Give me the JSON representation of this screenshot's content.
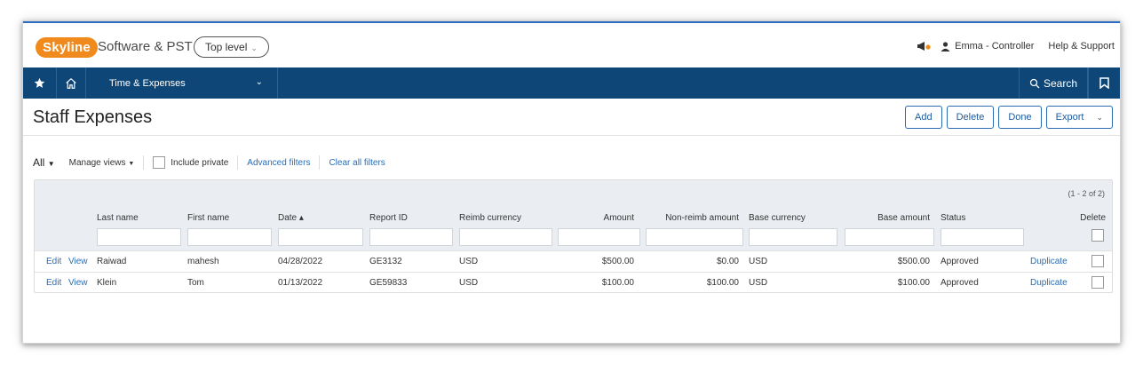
{
  "header": {
    "logo_text": "Skyline",
    "product_name": "Software & PST",
    "level_selector": "Top level",
    "user": "Emma - Controller",
    "help_link": "Help & Support"
  },
  "navbar": {
    "module": "Time & Expenses",
    "search_label": "Search"
  },
  "page": {
    "title": "Staff Expenses",
    "buttons": {
      "add": "Add",
      "delete": "Delete",
      "done": "Done",
      "export": "Export"
    }
  },
  "filters": {
    "view": "All",
    "manage_views": "Manage views",
    "include_private": "Include private",
    "advanced_filters": "Advanced filters",
    "clear_all_filters": "Clear all filters"
  },
  "grid": {
    "record_count": "(1 - 2 of 2)",
    "columns": [
      "Last name",
      "First name",
      "Date ▴",
      "Report ID",
      "Reimb currency",
      "Amount",
      "Non-reimb amount",
      "Base currency",
      "Base amount",
      "Status",
      "Delete"
    ],
    "rows": [
      {
        "edit": "Edit",
        "view": "View",
        "last_name": "Raiwad",
        "first_name": "mahesh",
        "date": "04/28/2022",
        "report_id": "GE3132",
        "reimb_currency": "USD",
        "amount": "$500.00",
        "non_reimb_amount": "$0.00",
        "base_currency": "USD",
        "base_amount": "$500.00",
        "status": "Approved",
        "duplicate": "Duplicate"
      },
      {
        "edit": "Edit",
        "view": "View",
        "last_name": "Klein",
        "first_name": "Tom",
        "date": "01/13/2022",
        "report_id": "GE59833",
        "reimb_currency": "USD",
        "amount": "$100.00",
        "non_reimb_amount": "$100.00",
        "base_currency": "USD",
        "base_amount": "$100.00",
        "status": "Approved",
        "duplicate": "Duplicate"
      }
    ]
  },
  "colors": {
    "brand_orange": "#f08a1c",
    "nav_blue": "#0e4677",
    "link_blue": "#2a6db5"
  },
  "icons": [
    "star-icon",
    "home-icon",
    "chevron-down-icon",
    "search-icon",
    "bookmark-icon",
    "megaphone-icon",
    "user-icon"
  ]
}
